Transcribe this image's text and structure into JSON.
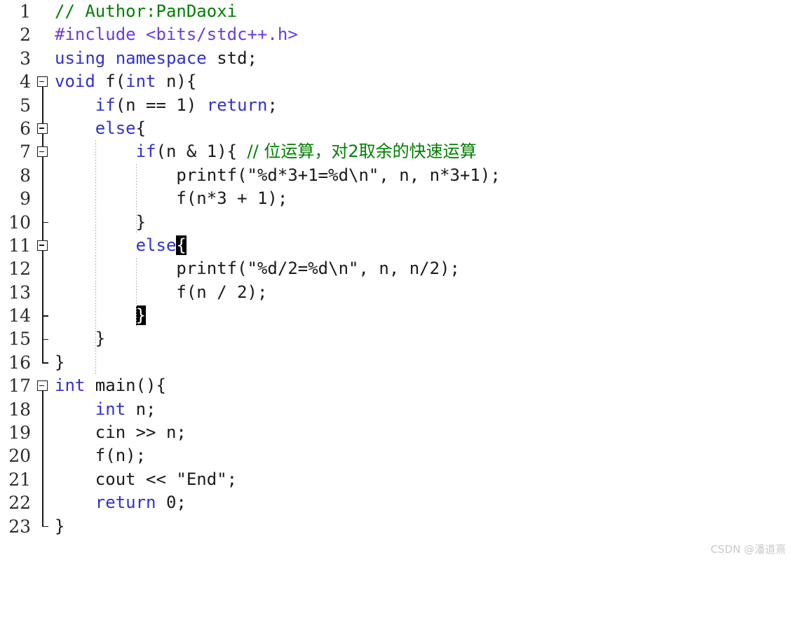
{
  "editor": {
    "language": "C++",
    "colors": {
      "background": "#ffffff",
      "keyword": "#3232c8",
      "preprocessor": "#6a3ce0",
      "comment": "#008000",
      "plain_text": "#1a1a1a",
      "line_number": "#2b2b2b",
      "indent_guide": "#b8b8b8",
      "brace_match_bg": "#000000",
      "brace_match_fg": "#ffffff"
    },
    "total_lines": 23,
    "lines": [
      {
        "n": "1",
        "fold": "none",
        "indent_guides": 0,
        "text": "// Author:PanDaoxi"
      },
      {
        "n": "2",
        "fold": "none",
        "indent_guides": 0,
        "text": "#include <bits/stdc++.h>"
      },
      {
        "n": "3",
        "fold": "none",
        "indent_guides": 0,
        "text": "using namespace std;"
      },
      {
        "n": "4",
        "fold": "box-open",
        "indent_guides": 0,
        "text": "void f(int n){"
      },
      {
        "n": "5",
        "fold": "line",
        "indent_guides": 0,
        "text": "    if(n == 1) return;"
      },
      {
        "n": "6",
        "fold": "box-middle",
        "indent_guides": 0,
        "text": "    else{"
      },
      {
        "n": "7",
        "fold": "box-middle",
        "indent_guides": 1,
        "text": "        if(n & 1){ // 位运算，对2取余的快速运算"
      },
      {
        "n": "8",
        "fold": "line",
        "indent_guides": 2,
        "text": "            printf(\"%d*3+1=%d\\n\", n, n*3+1);"
      },
      {
        "n": "9",
        "fold": "line",
        "indent_guides": 2,
        "text": "            f(n*3 + 1);"
      },
      {
        "n": "10",
        "fold": "tick",
        "indent_guides": 1,
        "text": "        }"
      },
      {
        "n": "11",
        "fold": "box-middle",
        "indent_guides": 1,
        "text": "        else{"
      },
      {
        "n": "12",
        "fold": "line",
        "indent_guides": 2,
        "text": "            printf(\"%d/2=%d\\n\", n, n/2);"
      },
      {
        "n": "13",
        "fold": "line",
        "indent_guides": 2,
        "text": "            f(n / 2);"
      },
      {
        "n": "14",
        "fold": "tick",
        "indent_guides": 1,
        "text": "        }"
      },
      {
        "n": "15",
        "fold": "tick",
        "indent_guides": 0,
        "text": "    }"
      },
      {
        "n": "16",
        "fold": "end",
        "indent_guides": 0,
        "text": "}"
      },
      {
        "n": "17",
        "fold": "box-open",
        "indent_guides": 0,
        "text": "int main(){"
      },
      {
        "n": "18",
        "fold": "line",
        "indent_guides": 0,
        "text": "    int n;"
      },
      {
        "n": "19",
        "fold": "line",
        "indent_guides": 0,
        "text": "    cin >> n;"
      },
      {
        "n": "20",
        "fold": "line",
        "indent_guides": 0,
        "text": "    f(n);"
      },
      {
        "n": "21",
        "fold": "line",
        "indent_guides": 0,
        "text": "    cout << \"End\";"
      },
      {
        "n": "22",
        "fold": "line",
        "indent_guides": 0,
        "text": "    return 0;"
      },
      {
        "n": "23",
        "fold": "end",
        "indent_guides": 0,
        "text": "}"
      }
    ],
    "brace_match": {
      "open_line": "11",
      "open_char": "{",
      "close_line": "14",
      "close_char": "}"
    },
    "comment_text": "// 位运算，对2取余的快速运算"
  },
  "watermark": {
    "text": "CSDN @潘道熹"
  }
}
